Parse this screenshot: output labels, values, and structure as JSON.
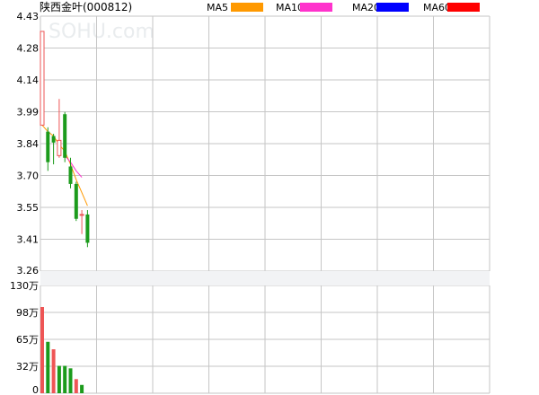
{
  "title": "陕西金叶(000812)",
  "watermark": "SOHU.com",
  "colors": {
    "background": "#ffffff",
    "grid": "#c6c6c6",
    "up": "#ee5555",
    "down": "#1c9b1c",
    "ma5": "#ff9900",
    "ma10": "#ff33cc",
    "ma20": "#0000ff",
    "ma60": "#ff0000",
    "separator_band": "#f2f3f5"
  },
  "legend": [
    {
      "label": "MA5",
      "color": "#ff9900"
    },
    {
      "label": "MA10",
      "color": "#ff33cc"
    },
    {
      "label": "MA20",
      "color": "#0000ff"
    },
    {
      "label": "MA60",
      "color": "#ff0000"
    }
  ],
  "chart_data": {
    "type": "candlestick",
    "price_axis": {
      "ticks": [
        "4.43",
        "4.28",
        "4.14",
        "3.99",
        "3.84",
        "3.70",
        "3.55",
        "3.41",
        "3.26"
      ],
      "range": [
        3.26,
        4.43
      ]
    },
    "volume_axis": {
      "ticks": [
        "130万",
        "98万",
        "65万",
        "32万",
        "0"
      ],
      "range": [
        0,
        130
      ]
    },
    "candles": [
      {
        "open": 3.93,
        "close": 4.36,
        "high": 4.36,
        "low": 3.93
      },
      {
        "open": 3.9,
        "close": 3.76,
        "high": 3.92,
        "low": 3.72
      },
      {
        "open": 3.88,
        "close": 3.85,
        "high": 3.89,
        "low": 3.75
      },
      {
        "open": 3.79,
        "close": 3.86,
        "high": 4.05,
        "low": 3.78
      },
      {
        "open": 3.98,
        "close": 3.78,
        "high": 3.99,
        "low": 3.76
      },
      {
        "open": 3.74,
        "close": 3.66,
        "high": 3.78,
        "low": 3.64
      },
      {
        "open": 3.66,
        "close": 3.5,
        "high": 3.67,
        "low": 3.49
      },
      {
        "open": 3.52,
        "close": 3.52,
        "high": 3.54,
        "low": 3.43
      },
      {
        "open": 3.52,
        "close": 3.39,
        "high": 3.54,
        "low": 3.37
      }
    ],
    "volume": [
      {
        "value": 104,
        "dir": "up"
      },
      {
        "value": 62,
        "dir": "down"
      },
      {
        "value": 53,
        "dir": "up"
      },
      {
        "value": 33,
        "dir": "down"
      },
      {
        "value": 33,
        "dir": "down"
      },
      {
        "value": 30,
        "dir": "down"
      },
      {
        "value": 17,
        "dir": "up"
      },
      {
        "value": 10,
        "dir": "down"
      }
    ],
    "ma5": [
      {
        "i": 0,
        "v": 3.93
      },
      {
        "i": 1,
        "v": 3.9
      },
      {
        "i": 2,
        "v": 3.88
      },
      {
        "i": 3,
        "v": 3.84
      },
      {
        "i": 4,
        "v": 3.81
      },
      {
        "i": 5,
        "v": 3.75
      },
      {
        "i": 6,
        "v": 3.68
      },
      {
        "i": 7,
        "v": 3.62
      },
      {
        "i": 8,
        "v": 3.56
      }
    ],
    "ma10": [
      {
        "i": 4,
        "v": 3.79
      },
      {
        "i": 5,
        "v": 3.76
      },
      {
        "i": 6,
        "v": 3.72
      },
      {
        "i": 7,
        "v": 3.69
      }
    ]
  }
}
